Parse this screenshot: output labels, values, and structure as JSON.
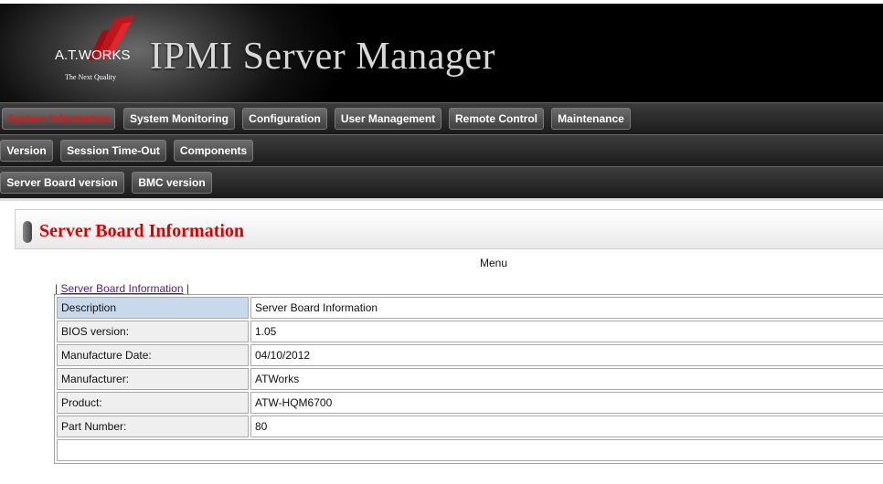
{
  "header": {
    "logo_text": "A.T.WORKS",
    "logo_tagline": "The Next Quality",
    "title": "IPMI Server Manager"
  },
  "nav_main": [
    {
      "label": "System Information",
      "active": true
    },
    {
      "label": "System Monitoring"
    },
    {
      "label": "Configuration"
    },
    {
      "label": "User Management"
    },
    {
      "label": "Remote Control"
    },
    {
      "label": "Maintenance"
    }
  ],
  "nav_sub": [
    {
      "label": "Version"
    },
    {
      "label": "Session Time-Out"
    },
    {
      "label": "Components"
    }
  ],
  "nav_sub2": [
    {
      "label": "Server Board version"
    },
    {
      "label": "BMC version"
    }
  ],
  "section": {
    "title": "Server Board Information"
  },
  "menu_label": "Menu",
  "crumbs": {
    "link": "Server Board Information"
  },
  "table": {
    "rows": [
      {
        "key": "Description",
        "value": "Server Board Information"
      },
      {
        "key": "BIOS version:",
        "value": "1.05"
      },
      {
        "key": "Manufacture Date:",
        "value": "04/10/2012"
      },
      {
        "key": "Manufacturer:",
        "value": "ATWorks"
      },
      {
        "key": "Product:",
        "value": "ATW-HQM6700"
      },
      {
        "key": "Part Number:",
        "value": "80"
      }
    ]
  },
  "colors": {
    "active_nav": "#ee1111",
    "section_title": "#dd0000",
    "highlight_cell": "#c9d9ec"
  }
}
